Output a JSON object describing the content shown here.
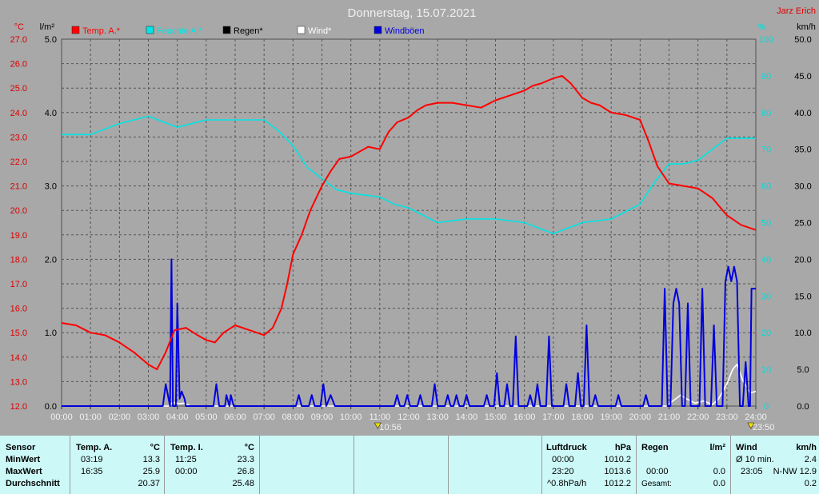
{
  "chart_data": {
    "type": "line",
    "title": "Donnerstag, 15.07.2021",
    "author": "Jarz Erich",
    "units": {
      "temp": "°C",
      "rain": "l/m²",
      "humidity": "%",
      "wind": "km/h"
    },
    "x_ticks": [
      "00:00",
      "01:00",
      "02:00",
      "03:00",
      "04:00",
      "05:00",
      "06:00",
      "07:00",
      "08:00",
      "09:00",
      "10:00",
      "11:00",
      "12:00",
      "13:00",
      "14:00",
      "15:00",
      "16:00",
      "17:00",
      "18:00",
      "19:00",
      "20:00",
      "21:00",
      "22:00",
      "23:00",
      "24:00"
    ],
    "x_range_hours": [
      0,
      24
    ],
    "temp_axis": {
      "range": [
        12.0,
        27.0
      ],
      "ticks": [
        "12.0",
        "13.0",
        "14.0",
        "15.0",
        "16.0",
        "17.0",
        "18.0",
        "19.0",
        "20.0",
        "21.0",
        "22.0",
        "23.0",
        "24.0",
        "25.0",
        "26.0",
        "27.0"
      ],
      "color": "#dd0000"
    },
    "rain_axis": {
      "range": [
        0.0,
        5.0
      ],
      "ticks": [
        "0.0",
        "1.0",
        "2.0",
        "3.0",
        "4.0",
        "5.0"
      ]
    },
    "humidity_axis": {
      "range": [
        0,
        100
      ],
      "ticks": [
        "0",
        "10",
        "20",
        "30",
        "40",
        "50",
        "60",
        "70",
        "80",
        "90",
        "100"
      ],
      "color": "#00dddd"
    },
    "wind_axis": {
      "range": [
        0.0,
        50.0
      ],
      "ticks": [
        "0.0",
        "5.0",
        "10.0",
        "15.0",
        "20.0",
        "25.0",
        "30.0",
        "35.0",
        "40.0",
        "45.0",
        "50.0"
      ]
    },
    "grid": true,
    "legend": [
      {
        "label": "Temp. A.*",
        "color": "#ff0000"
      },
      {
        "label": "Feuchte A.*",
        "color": "#00e5e5"
      },
      {
        "label": "Regen*",
        "color": "#000000"
      },
      {
        "label": "Wind*",
        "color": "#ffffff"
      },
      {
        "label": "Windböen",
        "color": "#0000dd"
      }
    ],
    "annotations": [
      {
        "label": "10:56",
        "hour": 10.93
      },
      {
        "label": "23:50",
        "hour": 23.83
      }
    ],
    "series": [
      {
        "name": "Temp. A.*",
        "axis": "temp",
        "color": "#ff0000",
        "points": [
          [
            0,
            15.4
          ],
          [
            0.5,
            15.3
          ],
          [
            1,
            15.0
          ],
          [
            1.5,
            14.9
          ],
          [
            2,
            14.6
          ],
          [
            2.5,
            14.2
          ],
          [
            3,
            13.7
          ],
          [
            3.3,
            13.5
          ],
          [
            3.6,
            14.2
          ],
          [
            3.9,
            15.1
          ],
          [
            4.3,
            15.2
          ],
          [
            4.7,
            14.9
          ],
          [
            5,
            14.7
          ],
          [
            5.3,
            14.6
          ],
          [
            5.6,
            15.0
          ],
          [
            6,
            15.3
          ],
          [
            6.5,
            15.1
          ],
          [
            7,
            14.9
          ],
          [
            7.3,
            15.2
          ],
          [
            7.6,
            16.0
          ],
          [
            7.8,
            17.0
          ],
          [
            8,
            18.2
          ],
          [
            8.3,
            19.0
          ],
          [
            8.6,
            20.0
          ],
          [
            9,
            21.0
          ],
          [
            9.3,
            21.6
          ],
          [
            9.6,
            22.1
          ],
          [
            10,
            22.2
          ],
          [
            10.3,
            22.4
          ],
          [
            10.6,
            22.6
          ],
          [
            11,
            22.5
          ],
          [
            11.3,
            23.2
          ],
          [
            11.6,
            23.6
          ],
          [
            12,
            23.8
          ],
          [
            12.3,
            24.1
          ],
          [
            12.6,
            24.3
          ],
          [
            13,
            24.4
          ],
          [
            13.5,
            24.4
          ],
          [
            14,
            24.3
          ],
          [
            14.5,
            24.2
          ],
          [
            15,
            24.5
          ],
          [
            15.5,
            24.7
          ],
          [
            16,
            24.9
          ],
          [
            16.3,
            25.1
          ],
          [
            16.6,
            25.2
          ],
          [
            17,
            25.4
          ],
          [
            17.3,
            25.5
          ],
          [
            17.6,
            25.2
          ],
          [
            18,
            24.6
          ],
          [
            18.3,
            24.4
          ],
          [
            18.6,
            24.3
          ],
          [
            19,
            24.0
          ],
          [
            19.5,
            23.9
          ],
          [
            20,
            23.7
          ],
          [
            20.3,
            22.8
          ],
          [
            20.6,
            21.8
          ],
          [
            21,
            21.1
          ],
          [
            21.5,
            21.0
          ],
          [
            22,
            20.9
          ],
          [
            22.5,
            20.5
          ],
          [
            23,
            19.8
          ],
          [
            23.5,
            19.4
          ],
          [
            24,
            19.2
          ]
        ]
      },
      {
        "name": "Feuchte A.*",
        "axis": "humidity",
        "color": "#00e5e5",
        "points": [
          [
            0,
            74
          ],
          [
            1,
            74
          ],
          [
            2,
            77
          ],
          [
            3,
            79
          ],
          [
            4,
            76
          ],
          [
            5,
            78
          ],
          [
            6,
            78
          ],
          [
            7,
            78
          ],
          [
            7.5,
            75
          ],
          [
            8,
            71
          ],
          [
            8.5,
            65
          ],
          [
            9,
            62
          ],
          [
            9.5,
            59
          ],
          [
            10,
            58
          ],
          [
            11,
            57
          ],
          [
            11.5,
            55
          ],
          [
            12,
            54
          ],
          [
            13,
            50
          ],
          [
            14,
            51
          ],
          [
            15,
            51
          ],
          [
            16,
            50
          ],
          [
            17,
            47
          ],
          [
            18,
            50
          ],
          [
            19,
            51
          ],
          [
            20,
            55
          ],
          [
            20.5,
            61
          ],
          [
            21,
            66
          ],
          [
            21.5,
            66
          ],
          [
            22,
            67
          ],
          [
            22.5,
            70
          ],
          [
            23,
            73
          ],
          [
            24,
            73
          ]
        ]
      },
      {
        "name": "Wind*",
        "axis": "wind",
        "color": "#ffffff",
        "points": [
          [
            0,
            0
          ],
          [
            3.7,
            0
          ],
          [
            3.85,
            0.5
          ],
          [
            4.05,
            0.3
          ],
          [
            4.25,
            0.4
          ],
          [
            4.45,
            0
          ],
          [
            20.9,
            0
          ],
          [
            21.1,
            0.6
          ],
          [
            21.4,
            1.5
          ],
          [
            21.6,
            1.0
          ],
          [
            21.9,
            0.4
          ],
          [
            22.2,
            0.7
          ],
          [
            22.5,
            0.2
          ],
          [
            22.7,
            0.9
          ],
          [
            23.0,
            3.0
          ],
          [
            23.2,
            5.0
          ],
          [
            23.35,
            5.7
          ],
          [
            23.55,
            3.5
          ],
          [
            23.8,
            1.8
          ],
          [
            24,
            2.0
          ]
        ]
      },
      {
        "name": "Windböen",
        "axis": "wind",
        "color": "#0000dd",
        "points": [
          [
            0,
            0
          ],
          [
            3.5,
            0
          ],
          [
            3.6,
            3
          ],
          [
            3.75,
            0
          ],
          [
            3.8,
            20
          ],
          [
            3.85,
            0
          ],
          [
            3.95,
            0
          ],
          [
            4.0,
            14
          ],
          [
            4.08,
            1
          ],
          [
            4.15,
            2
          ],
          [
            4.25,
            1
          ],
          [
            4.3,
            0
          ],
          [
            5.25,
            0
          ],
          [
            5.35,
            3
          ],
          [
            5.45,
            0
          ],
          [
            5.65,
            0
          ],
          [
            5.7,
            1.5
          ],
          [
            5.8,
            0
          ],
          [
            5.85,
            1.5
          ],
          [
            5.95,
            0
          ],
          [
            8.1,
            0
          ],
          [
            8.2,
            1.5
          ],
          [
            8.3,
            0
          ],
          [
            8.55,
            0
          ],
          [
            8.65,
            1.5
          ],
          [
            8.75,
            0
          ],
          [
            8.95,
            0
          ],
          [
            9.05,
            3
          ],
          [
            9.15,
            0
          ],
          [
            9.3,
            1.5
          ],
          [
            9.45,
            0
          ],
          [
            11.5,
            0
          ],
          [
            11.6,
            1.5
          ],
          [
            11.7,
            0
          ],
          [
            11.85,
            0
          ],
          [
            11.95,
            1.5
          ],
          [
            12.05,
            0
          ],
          [
            12.3,
            0
          ],
          [
            12.4,
            1.5
          ],
          [
            12.5,
            0
          ],
          [
            12.8,
            0
          ],
          [
            12.9,
            3
          ],
          [
            13.0,
            0
          ],
          [
            13.25,
            0
          ],
          [
            13.35,
            1.5
          ],
          [
            13.45,
            0
          ],
          [
            13.55,
            0
          ],
          [
            13.65,
            1.5
          ],
          [
            13.75,
            0
          ],
          [
            13.9,
            0
          ],
          [
            14.0,
            1.5
          ],
          [
            14.1,
            0
          ],
          [
            14.6,
            0
          ],
          [
            14.7,
            1.5
          ],
          [
            14.8,
            0
          ],
          [
            14.95,
            0
          ],
          [
            15.05,
            4.5
          ],
          [
            15.15,
            0
          ],
          [
            15.3,
            0
          ],
          [
            15.4,
            3
          ],
          [
            15.5,
            0
          ],
          [
            15.6,
            0
          ],
          [
            15.7,
            9.5
          ],
          [
            15.8,
            0
          ],
          [
            16.1,
            0
          ],
          [
            16.2,
            1.5
          ],
          [
            16.3,
            0
          ],
          [
            16.35,
            0
          ],
          [
            16.45,
            3
          ],
          [
            16.55,
            0
          ],
          [
            16.75,
            0
          ],
          [
            16.85,
            9.5
          ],
          [
            16.95,
            0
          ],
          [
            17.35,
            0
          ],
          [
            17.45,
            3
          ],
          [
            17.55,
            0
          ],
          [
            17.75,
            0
          ],
          [
            17.85,
            4.5
          ],
          [
            17.95,
            0
          ],
          [
            18.05,
            0
          ],
          [
            18.15,
            11
          ],
          [
            18.25,
            0
          ],
          [
            18.35,
            0
          ],
          [
            18.45,
            1.5
          ],
          [
            18.55,
            0
          ],
          [
            19.15,
            0
          ],
          [
            19.25,
            1.5
          ],
          [
            19.35,
            0
          ],
          [
            20.1,
            0
          ],
          [
            20.2,
            1.5
          ],
          [
            20.3,
            0
          ],
          [
            20.75,
            0
          ],
          [
            20.85,
            16
          ],
          [
            20.95,
            0
          ],
          [
            21.05,
            0
          ],
          [
            21.15,
            14
          ],
          [
            21.25,
            16
          ],
          [
            21.35,
            14
          ],
          [
            21.45,
            0
          ],
          [
            21.55,
            0
          ],
          [
            21.65,
            14
          ],
          [
            21.75,
            0
          ],
          [
            22.05,
            0
          ],
          [
            22.15,
            16
          ],
          [
            22.25,
            0
          ],
          [
            22.45,
            0
          ],
          [
            22.55,
            11
          ],
          [
            22.65,
            0
          ],
          [
            22.85,
            0
          ],
          [
            22.95,
            17
          ],
          [
            23.05,
            19
          ],
          [
            23.15,
            17
          ],
          [
            23.25,
            19
          ],
          [
            23.35,
            17
          ],
          [
            23.45,
            0
          ],
          [
            23.55,
            0
          ],
          [
            23.65,
            6
          ],
          [
            23.75,
            0
          ],
          [
            23.8,
            0
          ],
          [
            23.85,
            16
          ],
          [
            24,
            16
          ]
        ]
      }
    ]
  },
  "table": {
    "sections": [
      {
        "header": [
          "Sensor"
        ],
        "rows": [
          [
            "MinWert"
          ],
          [
            "MaxWert"
          ],
          [
            "Durchschnitt"
          ]
        ]
      },
      {
        "header": [
          "Temp. A.",
          "°C"
        ],
        "rows": [
          [
            "03:19",
            "13.3"
          ],
          [
            "16:35",
            "25.9"
          ],
          [
            "",
            "20.37"
          ]
        ]
      },
      {
        "header": [
          "Temp. I.",
          "°C"
        ],
        "rows": [
          [
            "11:25",
            "23.3"
          ],
          [
            "00:00",
            "26.8"
          ],
          [
            "",
            "25.48"
          ]
        ]
      },
      {
        "header": [
          "Luftdruck",
          "hPa"
        ],
        "rows": [
          [
            "00:00",
            "1010.2"
          ],
          [
            "23:20",
            "1013.6"
          ],
          [
            "^0.8hPa/h",
            "1012.2"
          ]
        ]
      },
      {
        "header": [
          "Regen",
          "l/m²"
        ],
        "rows": [
          [
            "",
            ""
          ],
          [
            "00:00",
            "0.0"
          ],
          [
            "Gesamt:",
            "0.0"
          ]
        ]
      },
      {
        "header": [
          "Wind",
          "km/h"
        ],
        "rows": [
          [
            "Ø 10 min.",
            "2.4"
          ],
          [
            "23:05",
            "N-NW 12.9"
          ],
          [
            "",
            "0.2"
          ]
        ]
      }
    ]
  }
}
